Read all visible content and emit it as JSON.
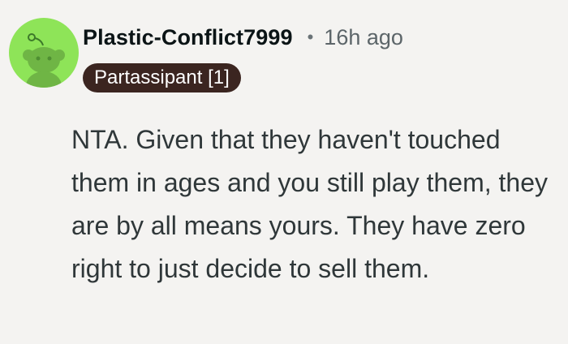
{
  "comment": {
    "author": "Plastic-Conflict7999",
    "separator": "•",
    "timestamp": "16h ago",
    "flair": "Partassipant [1]",
    "body": "NTA. Given that they haven't touched them in ages and you still play them, they are by all means yours. They have zero right to just decide to sell them.",
    "avatar_icon": "snoo-avatar-icon"
  },
  "colors": {
    "background": "#f4f3f1",
    "avatar_bg": "#8ee458",
    "flair_bg": "#3b2520",
    "username": "#0b1416",
    "body_text": "#2f3739"
  }
}
